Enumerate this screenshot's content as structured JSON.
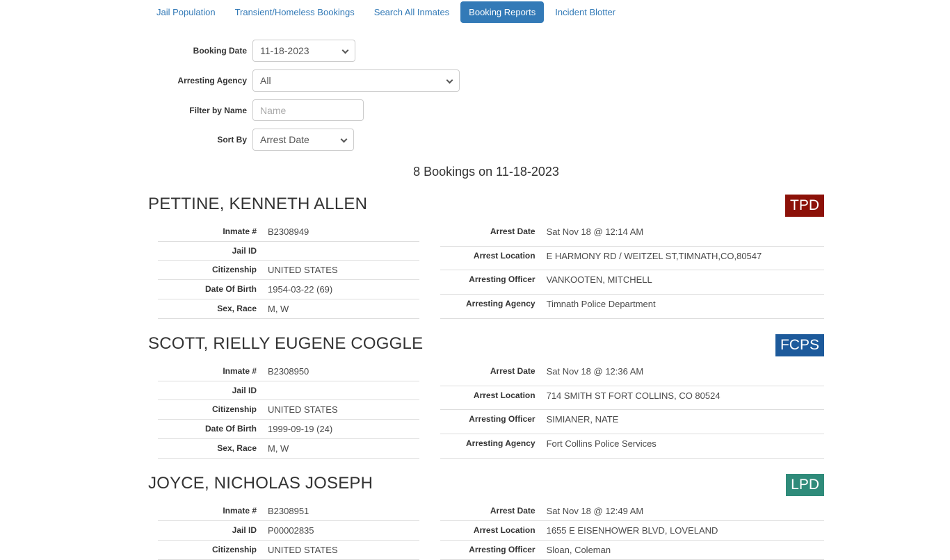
{
  "colors": {
    "accent": "#337ab7",
    "badge_tpd": "#8c1108",
    "badge_fcps": "#1d5a9b",
    "badge_lpd": "#2f8b7a"
  },
  "nav": {
    "tabs": [
      "Jail Population",
      "Transient/Homeless Bookings",
      "Search All Inmates",
      "Booking Reports",
      "Incident Blotter"
    ],
    "active_tab": "Booking Reports"
  },
  "filters": {
    "booking_date": {
      "label": "Booking Date",
      "value": "11-18-2023"
    },
    "arresting_agency": {
      "label": "Arresting Agency",
      "value": "All"
    },
    "name": {
      "label": "Filter by Name",
      "placeholder": "Name"
    },
    "sort_by": {
      "label": "Sort By",
      "value": "Arrest Date"
    }
  },
  "summary": {
    "text": "8 Bookings on 11-18-2023"
  },
  "field_labels": {
    "inmate_number": "Inmate #",
    "jail_id": "Jail ID",
    "citizenship": "Citizenship",
    "date_of_birth": "Date Of Birth",
    "sex_race": "Sex, Race",
    "arrest_date": "Arrest Date",
    "arrest_location": "Arrest Location",
    "arresting_officer": "Arresting Officer",
    "arresting_agency": "Arresting Agency"
  },
  "bookings": [
    {
      "name": "PETTINE, KENNETH ALLEN",
      "badge": "TPD",
      "badge_color": "#8c1108",
      "inmate_number": "B2308949",
      "jail_id": "",
      "citizenship": "UNITED STATES",
      "date_of_birth": "1954-03-22 (69)",
      "sex_race": "M, W",
      "arrest_date": "Sat Nov 18 @ 12:14 AM",
      "arrest_location": "E HARMONY RD / WEITZEL ST,TIMNATH,CO,80547",
      "arresting_officer": "VANKOOTEN, MITCHELL",
      "arresting_agency": "Timnath Police Department"
    },
    {
      "name": "SCOTT, RIELLY EUGENE COGGLE",
      "badge": "FCPS",
      "badge_color": "#1d5a9b",
      "inmate_number": "B2308950",
      "jail_id": "",
      "citizenship": "UNITED STATES",
      "date_of_birth": "1999-09-19 (24)",
      "sex_race": "M, W",
      "arrest_date": "Sat Nov 18 @ 12:36 AM",
      "arrest_location": "714 SMITH ST FORT COLLINS, CO 80524",
      "arresting_officer": "SIMIANER, NATE",
      "arresting_agency": "Fort Collins Police Services"
    },
    {
      "name": "JOYCE, NICHOLAS JOSEPH",
      "badge": "LPD",
      "badge_color": "#2f8b7a",
      "inmate_number": "B2308951",
      "jail_id": "P00002835",
      "citizenship": "UNITED STATES",
      "arrest_date": "Sat Nov 18 @ 12:49 AM",
      "arrest_location": "1655 E EISENHOWER BLVD, LOVELAND",
      "arresting_officer": "Sloan, Coleman"
    }
  ]
}
